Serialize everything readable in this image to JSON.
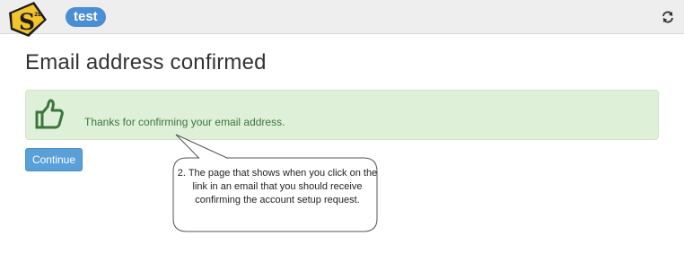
{
  "header": {
    "brand_label": "test",
    "logo_icon": "s2d-logo-icon",
    "refresh_icon": "refresh-icon"
  },
  "main": {
    "page_title": "Email address confirmed",
    "alert": {
      "icon": "thumbs-up-icon",
      "message": "Thanks for confirming your email address.",
      "color": "#3c763d",
      "background": "#dff0d8"
    },
    "continue_label": "Continue"
  },
  "annotation": {
    "text": "2. The page that shows when you click on the link in an email that you should receive confirming the account setup request."
  },
  "colors": {
    "accent": "#4a8fd4",
    "button": "#5aa0d8"
  }
}
